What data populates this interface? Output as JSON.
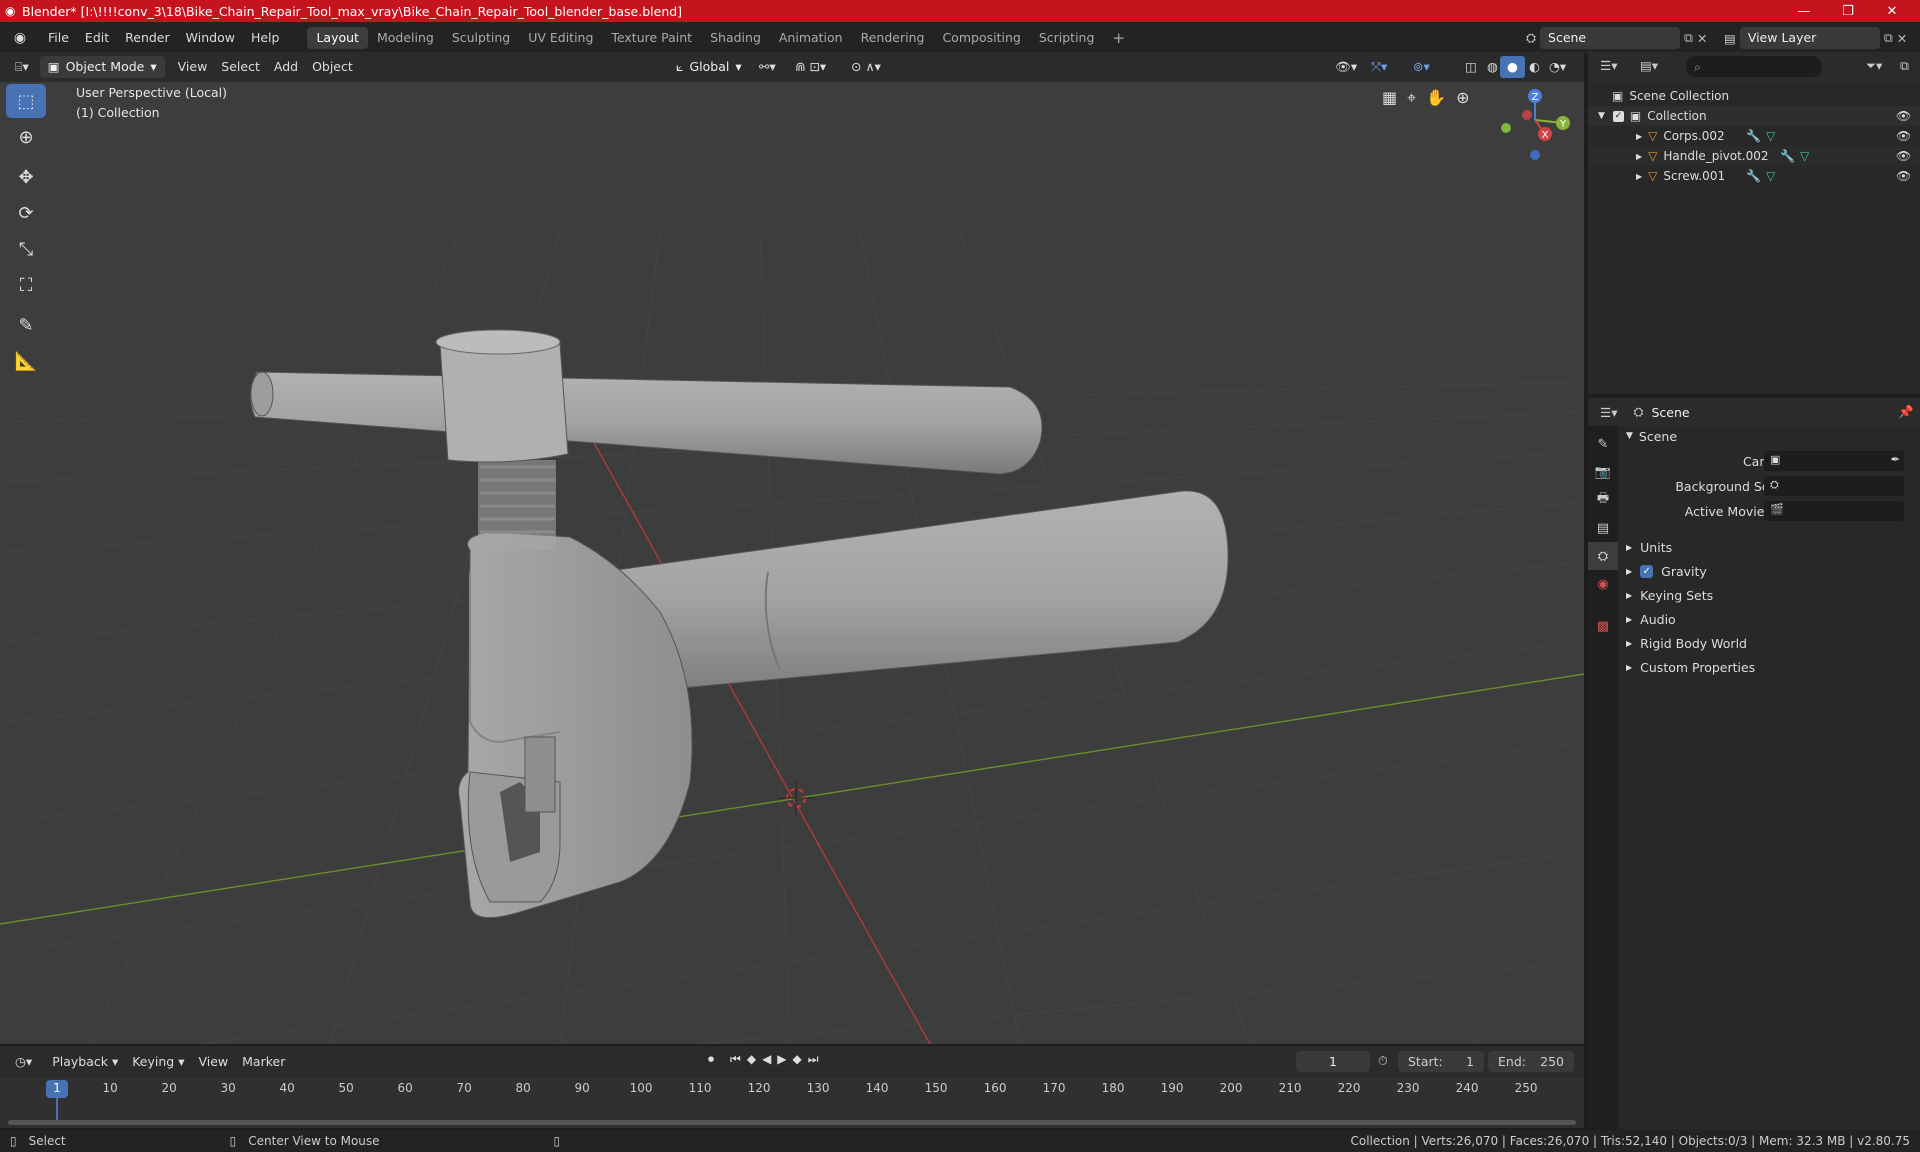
{
  "titlebar": {
    "title": "Blender* [I:\\!!!!conv_3\\18\\Bike_Chain_Repair_Tool_max_vray\\Bike_Chain_Repair_Tool_blender_base.blend]"
  },
  "menu": [
    "File",
    "Edit",
    "Render",
    "Window",
    "Help"
  ],
  "workspaces": [
    "Layout",
    "Modeling",
    "Sculpting",
    "UV Editing",
    "Texture Paint",
    "Shading",
    "Animation",
    "Rendering",
    "Compositing",
    "Scripting"
  ],
  "scene_field": "Scene",
  "view_layer_field": "View Layer",
  "viewport_header": {
    "mode": "Object Mode",
    "menus": [
      "View",
      "Select",
      "Add",
      "Object"
    ],
    "orientation": "Global"
  },
  "viewport": {
    "perspective": "User Perspective (Local)",
    "collection": "(1) Collection",
    "gizmo": {
      "z": "Z",
      "y": "Y",
      "x": "X"
    }
  },
  "outliner": {
    "root": "Scene Collection",
    "collection": "Collection",
    "objects": [
      "Corps.002",
      "Handle_pivot.002",
      "Screw.001"
    ]
  },
  "properties": {
    "header": "Scene",
    "panel": "Scene",
    "camera_label": "Camera",
    "background_label": "Background Scene",
    "movie_clip_label": "Active Movie Clip",
    "sections": [
      "Units",
      "Gravity",
      "Keying Sets",
      "Audio",
      "Rigid Body World",
      "Custom Properties"
    ],
    "gravity_checked": true
  },
  "timeline": {
    "menus": [
      "Playback",
      "Keying",
      "View",
      "Marker"
    ],
    "current_frame": "1",
    "start_label": "Start:",
    "start": "1",
    "end_label": "End:",
    "end": "250",
    "ticks": [
      "1",
      "10",
      "20",
      "30",
      "40",
      "50",
      "60",
      "70",
      "80",
      "90",
      "100",
      "110",
      "120",
      "130",
      "140",
      "150",
      "160",
      "170",
      "180",
      "190",
      "200",
      "210",
      "220",
      "230",
      "240",
      "250"
    ]
  },
  "statusbar": {
    "left1": "Select",
    "left2": "Center View to Mouse",
    "right": "Collection | Verts:26,070 | Faces:26,070 | Tris:52,140 | Objects:0/3 | Mem: 32.3 MB | v2.80.75"
  },
  "colors": {
    "accent": "#4772b3",
    "titlebar": "#c4141d",
    "x_axis": "#c83c3c",
    "y_axis": "#7aa02c",
    "object_icon": "#e8953a"
  }
}
